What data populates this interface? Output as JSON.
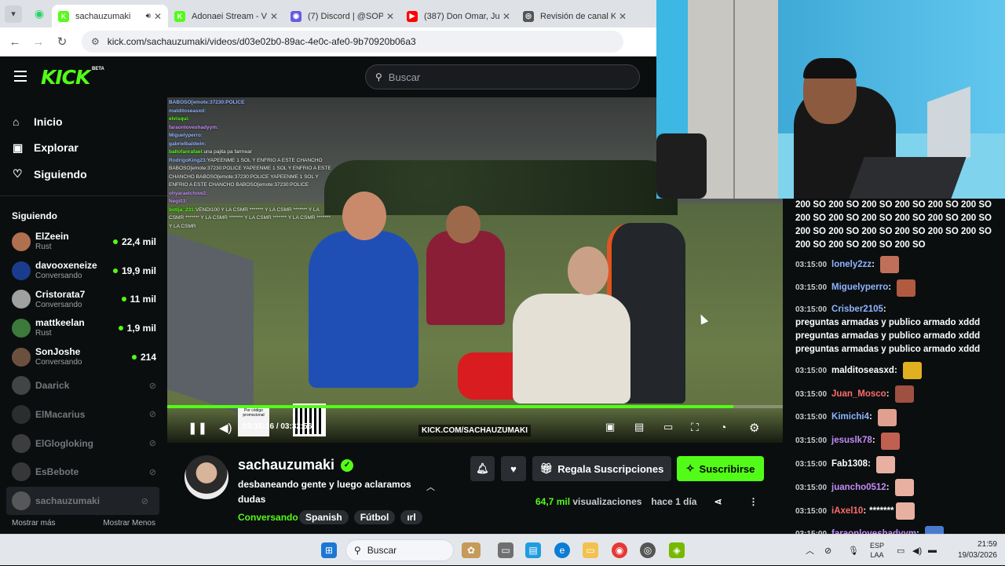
{
  "browser": {
    "tabs": [
      {
        "label": "sachauzumaki",
        "fav_color": "#53fc18",
        "fav": "K",
        "active": true
      },
      {
        "label": "Adonaei Stream - V",
        "fav_color": "#53fc18",
        "fav": "K",
        "active": false
      },
      {
        "label": "(7) Discord | @SOP",
        "fav_color": "#6a5ae0",
        "fav": "◉",
        "active": false
      },
      {
        "label": "(387) Don Omar, Ju",
        "fav_color": "#ff0000",
        "fav": "▶",
        "active": false
      },
      {
        "label": "Revisión de canal K",
        "fav_color": "#555555",
        "fav": "◎",
        "active": false
      }
    ],
    "url": "kick.com/sachauzumaki/videos/d03e02b0-89ac-4e0c-afe0-9b70920b06a3"
  },
  "header": {
    "logo": "KICK",
    "beta": "BETA",
    "search_placeholder": "Buscar"
  },
  "sidebar": {
    "nav": [
      {
        "icon": "⌂",
        "label": "Inicio"
      },
      {
        "icon": "▣",
        "label": "Explorar"
      },
      {
        "icon": "♡",
        "label": "Siguiendo"
      }
    ],
    "section_title": "Siguiendo",
    "following": [
      {
        "name": "ElZeein",
        "category": "Rust",
        "viewers": "22,4 mil",
        "live": true,
        "color": "#b07050"
      },
      {
        "name": "davooxeneize",
        "category": "Conversando",
        "viewers": "19,9 mil",
        "live": true,
        "color": "#1b3c8c"
      },
      {
        "name": "Cristorata7",
        "category": "Conversando",
        "viewers": "11 mil",
        "live": true,
        "color": "#a0a0a0"
      },
      {
        "name": "mattkeelan",
        "category": "Rust",
        "viewers": "1,9 mil",
        "live": true,
        "color": "#3c7a3c"
      },
      {
        "name": "SonJoshe",
        "category": "Conversando",
        "viewers": "214",
        "live": true,
        "color": "#6b5040"
      },
      {
        "name": "Daarick",
        "live": false,
        "color": "#888888"
      },
      {
        "name": "ElMacarius",
        "live": false,
        "color": "#555555"
      },
      {
        "name": "ElGlogloking",
        "live": false,
        "color": "#777777"
      },
      {
        "name": "EsBebote",
        "live": false,
        "color": "#6a6a6a"
      },
      {
        "name": "sachauzumaki",
        "live": false,
        "color": "#999999",
        "selected": true
      }
    ],
    "show_more": "Mostrar más",
    "show_less": "Mostrar Menos"
  },
  "video": {
    "overlay_chat": [
      {
        "user": "BABOSO[emote:37230:POLICE",
        "msg": ""
      },
      {
        "user": "malditoseasxd:",
        "msg": ""
      },
      {
        "user": "elvisqui:",
        "msg": ""
      },
      {
        "user": "faraonloveshadyym:",
        "msg": ""
      },
      {
        "user": "Miguelyperro:",
        "msg": ""
      },
      {
        "user": "gabrielbaldwin:",
        "msg": ""
      },
      {
        "user": "ballofanrafael:",
        "msg": "una pajita pa farmear"
      },
      {
        "user": "RodrigoKing23:",
        "msg": "YAPEENME 1 SOL Y ENFRIO A ESTE CHANCHO BABOSO[emote:37230:POLICE YAPEENME 1 SOL Y ENFRIO A ESTE CHANCHO BABOSO[emote:37230:POLICE YAPEENME 1 SOL Y ENFRIO A ESTE CHANCHO BABOSO[emote:37230:POLICE"
      },
      {
        "user": "ohyaraelchow2:",
        "msg": ""
      },
      {
        "user": "Negi03:",
        "msg": ""
      },
      {
        "user": "botija_231:",
        "msg": "VENDI100 Y LA CSMR ******* Y LA CSMR ******* Y LA CSMR ******* Y LA CSMR ******* Y LA CSMR ******* Y LA CSMR ******* Y LA CSMR"
      }
    ],
    "promo_label": "Por código promocional",
    "time_current": "03:15:36",
    "time_sep": "/",
    "time_total": "03:32:56",
    "progress": 0.92,
    "kick_url_label": "KICK.COM/SACHAUZUMAKI"
  },
  "channel": {
    "name": "sachauzumaki",
    "title": "desbaneando gente y luego aclaramos dudas",
    "category": "Conversando",
    "tags": [
      "Spanish",
      "Fútbol",
      "ırl"
    ],
    "gift_label": "Regala Suscripciones",
    "subscribe_label": "Suscribirse",
    "views_num": "64,7 mil",
    "views_label": "visualizaciones",
    "ago": "hace 1 día"
  },
  "chat": {
    "spam_text": "200 SO 200 SO 200 SO 200 SO 200 SO 200 SO 200 SO 200 SO 200 SO 200 SO 200 SO 200 SO 200 SO 200 SO 200 SO 200 SO 200 SO 200 SO 200 SO 200 SO 200 SO 200 SO",
    "messages": [
      {
        "time": "03:15:00",
        "user": "lonely2zz",
        "color": "#8fb4ff",
        "msg": "",
        "emote": "#c0705a"
      },
      {
        "time": "03:15:00",
        "user": "Miguelyperro",
        "color": "#8fb4ff",
        "msg": "",
        "emote": "#b05a40"
      },
      {
        "time": "03:15:00",
        "user": "Crisber2105",
        "color": "#8fb4ff",
        "msg": "preguntas armadas y publico armado xddd preguntas armadas y publico armado xddd preguntas armadas y publico armado xddd",
        "emote": ""
      },
      {
        "time": "03:15:00",
        "user": "malditoseasxd",
        "color": "#ffffff",
        "msg": "",
        "emote": "#e0b020"
      },
      {
        "time": "03:15:00",
        "user": "Juan_Mosco",
        "color": "#ff6b6b",
        "msg": "",
        "emote": "#a05040"
      },
      {
        "time": "03:15:00",
        "user": "Kimichi4",
        "color": "#8fb4ff",
        "msg": "",
        "emote": "#e0a090"
      },
      {
        "time": "03:15:00",
        "user": "jesuslk78",
        "color": "#c48bf7",
        "msg": "",
        "emote": "#c06050"
      },
      {
        "time": "03:15:00",
        "user": "Fab1308",
        "color": "#ffffff",
        "msg": "",
        "emote": "#e8b0a0"
      },
      {
        "time": "03:15:00",
        "user": "juancho0512",
        "color": "#c48bf7",
        "msg": "",
        "emote": "#e8b0a0"
      },
      {
        "time": "03:15:00",
        "user": "iAxel10",
        "color": "#ff6b6b",
        "msg": "*******",
        "emote": "#e8b0a0"
      },
      {
        "time": "03:15:00",
        "user": "faraonloveshadyym",
        "color": "#c48bf7",
        "msg": "",
        "emote": "#4a7ad0"
      }
    ]
  },
  "taskbar": {
    "search": "Buscar",
    "lang1": "ESP",
    "lang2": "LAA",
    "time": "21:59",
    "date": "19/03/2026"
  }
}
